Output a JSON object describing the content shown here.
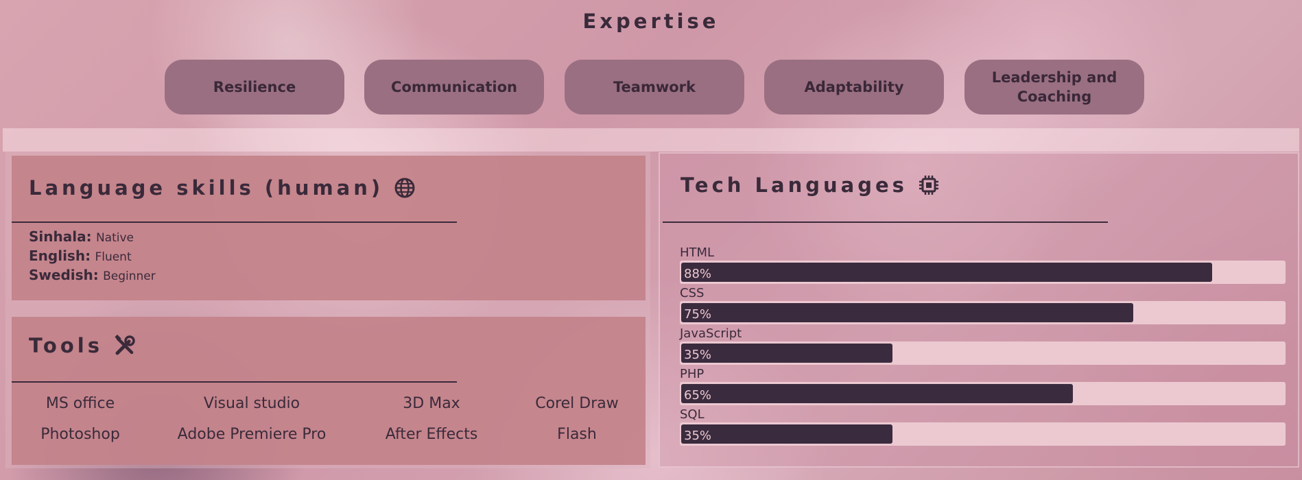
{
  "expertise": {
    "title": "Expertise",
    "pills": [
      "Resilience",
      "Communication",
      "Teamwork",
      "Adaptability",
      "Leadership and Coaching"
    ]
  },
  "language_skills": {
    "title": "Language skills (human)",
    "icon": "globe-icon",
    "items": [
      {
        "language": "Sinhala:",
        "level": "Native"
      },
      {
        "language": "English:",
        "level": "Fluent"
      },
      {
        "language": "Swedish:",
        "level": "Beginner"
      }
    ]
  },
  "tools": {
    "title": "Tools",
    "icon": "tools-icon",
    "items": [
      "MS office",
      "Visual studio",
      "3D Max",
      "Corel Draw",
      "Photoshop",
      "Adobe Premiere Pro",
      "After Effects",
      "Flash"
    ]
  },
  "tech_languages": {
    "title": "Tech Languages",
    "icon": "chip-icon",
    "bars": [
      {
        "name": "HTML",
        "percent_label": "88%",
        "percent": 88
      },
      {
        "name": "CSS",
        "percent_label": "75%",
        "percent": 75
      },
      {
        "name": "JavaScript",
        "percent_label": "35%",
        "percent": 35
      },
      {
        "name": "PHP",
        "percent_label": "65%",
        "percent": 65
      },
      {
        "name": "SQL",
        "percent_label": "35%",
        "percent": 35
      }
    ]
  },
  "colors": {
    "pill": "#9a6f82",
    "panel": "#c3828a",
    "bar_fill": "#3b2b3e",
    "bar_track": "#ecc9d1",
    "text": "#3a2a3a"
  }
}
